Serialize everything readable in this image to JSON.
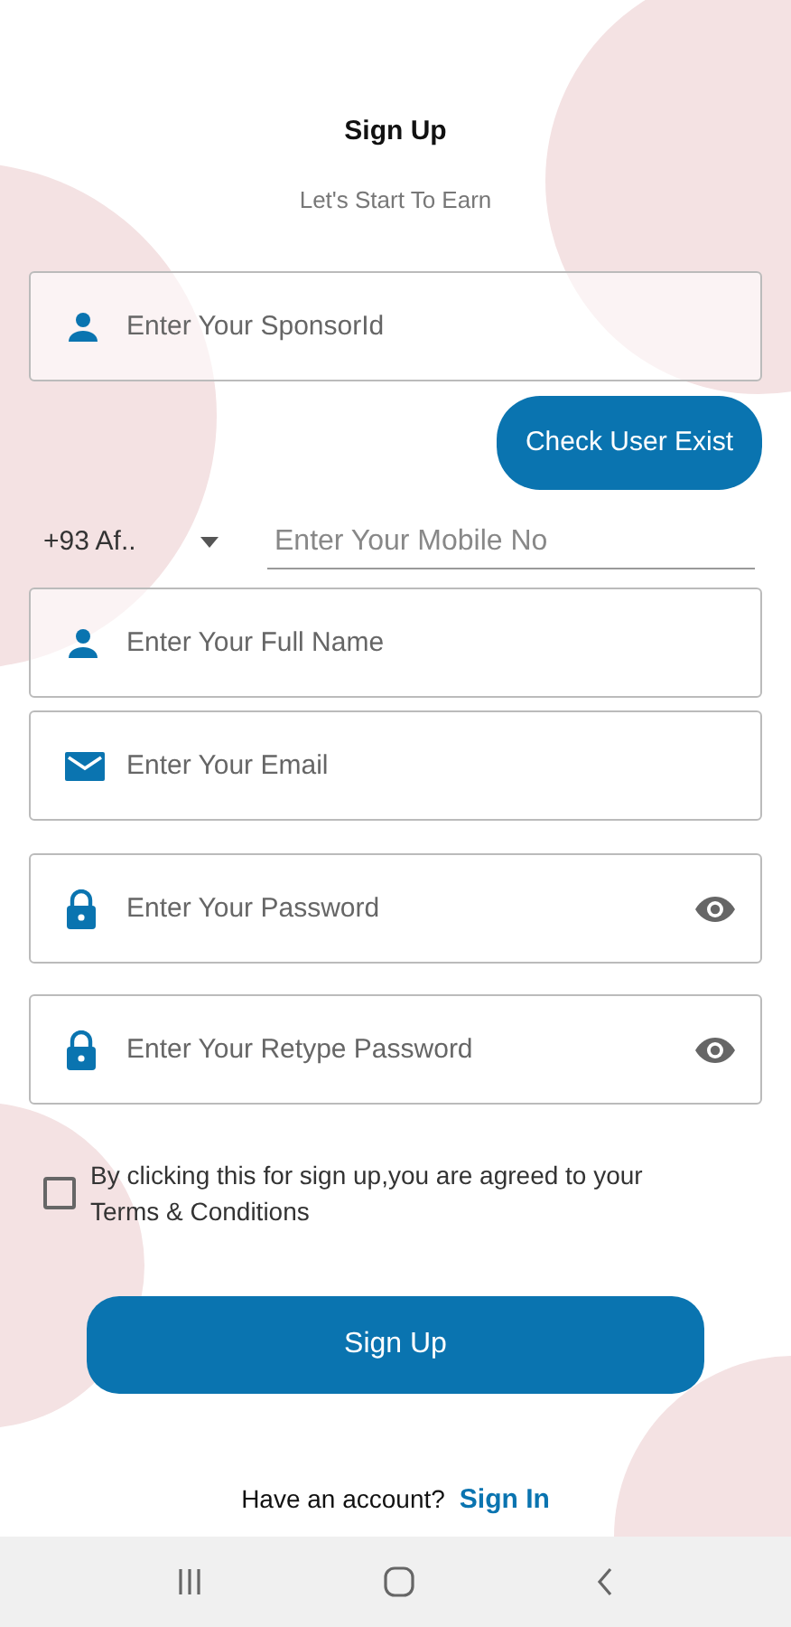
{
  "header": {
    "title": "Sign Up",
    "subtitle": "Let's Start To Earn"
  },
  "sponsor": {
    "kind": "person",
    "placeholder": "Enter Your SponsorId"
  },
  "check_button": "Check User Exist",
  "phone": {
    "country_code": "+93 Af..",
    "placeholder": "Enter Your Mobile No"
  },
  "fields": [
    {
      "kind": "person",
      "placeholder": "Enter Your Full Name"
    },
    {
      "kind": "email",
      "placeholder": "Enter Your Email"
    },
    {
      "kind": "password",
      "placeholder": "Enter Your Password"
    },
    {
      "kind": "password",
      "placeholder": "Enter Your Retype Password"
    }
  ],
  "terms": {
    "checked": false,
    "text": "By clicking this for sign up,you are agreed to your Terms & Conditions"
  },
  "submit_button": "Sign Up",
  "footer": {
    "text": "Have an account?",
    "link": "Sign In"
  }
}
